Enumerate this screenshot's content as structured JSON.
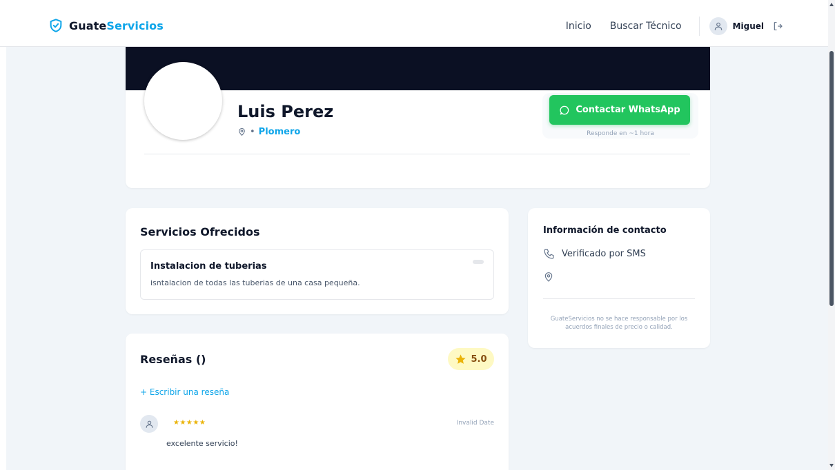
{
  "header": {
    "brand_part1": "Guate",
    "brand_part2": "Servicios",
    "nav": {
      "home": "Inicio",
      "search": "Buscar Técnico"
    },
    "user": {
      "name": "Miguel"
    }
  },
  "profile": {
    "name": "Luis Perez",
    "separator": "•",
    "profession": "Plomero",
    "whatsapp_label": "Contactar WhatsApp",
    "response_note": "Responde en ~1 hora"
  },
  "services": {
    "title": "Servicios Ofrecidos",
    "items": [
      {
        "title": "Instalacion de tuberias",
        "description": "isntalacion de todas las tuberias de una casa pequeña."
      }
    ]
  },
  "contact": {
    "title": "Información de contacto",
    "verified": "Verificado por SMS",
    "disclaimer": "GuateServicios no se hace responsable por los acuerdos finales de precio o calidad."
  },
  "reviews": {
    "title": "Reseñas ()",
    "rating": "5.0",
    "write_label": "+ Escribir una reseña",
    "items": [
      {
        "stars": "★★★★★",
        "date": "Invalid Date",
        "text": "excelente servicio!"
      }
    ]
  },
  "colors": {
    "accent": "#0ea5e9",
    "whatsapp": "#22c55e",
    "banner": "#0b1023",
    "star": "#eab308"
  }
}
